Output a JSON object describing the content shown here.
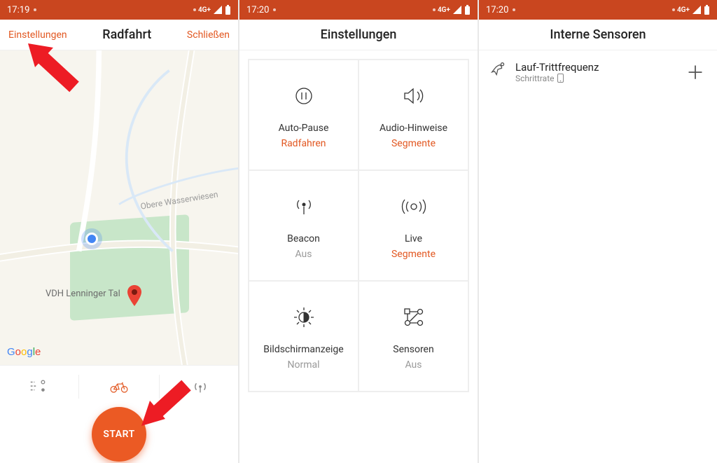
{
  "colors": {
    "brand": "#E25822",
    "statusbar": "#C9461F"
  },
  "screen1": {
    "time": "17:19",
    "network": "4G+",
    "header": {
      "left": "Einstellungen",
      "title": "Radfahrt",
      "right": "Schließen"
    },
    "map": {
      "road_label": "Obere Wasserwiesen",
      "poi": "VDH Lenninger Tal",
      "attribution": "Google"
    },
    "tabs": {
      "route": "route-icon",
      "bike": "bike-icon",
      "sensor": "beacon-icon"
    },
    "start_label": "START"
  },
  "screen2": {
    "time": "17:20",
    "network": "4G+",
    "header": {
      "title": "Einstellungen"
    },
    "cells": [
      {
        "icon": "pause-icon",
        "label": "Auto-Pause",
        "value": "Radfahren",
        "state": "on"
      },
      {
        "icon": "speaker-icon",
        "label": "Audio-Hinweise",
        "value": "Segmente",
        "state": "on"
      },
      {
        "icon": "beacon-icon",
        "label": "Beacon",
        "value": "Aus",
        "state": "off"
      },
      {
        "icon": "live-icon",
        "label": "Live",
        "value": "Segmente",
        "state": "on"
      },
      {
        "icon": "brightness-icon",
        "label": "Bildschirmanzeige",
        "value": "Normal",
        "state": "off"
      },
      {
        "icon": "sensors-icon",
        "label": "Sensoren",
        "value": "Aus",
        "state": "off"
      }
    ]
  },
  "screen3": {
    "time": "17:20",
    "network": "4G+",
    "header": {
      "title": "Interne Sensoren"
    },
    "sensor": {
      "title": "Lauf-Trittfrequenz",
      "subtitle": "Schrittrate"
    }
  }
}
